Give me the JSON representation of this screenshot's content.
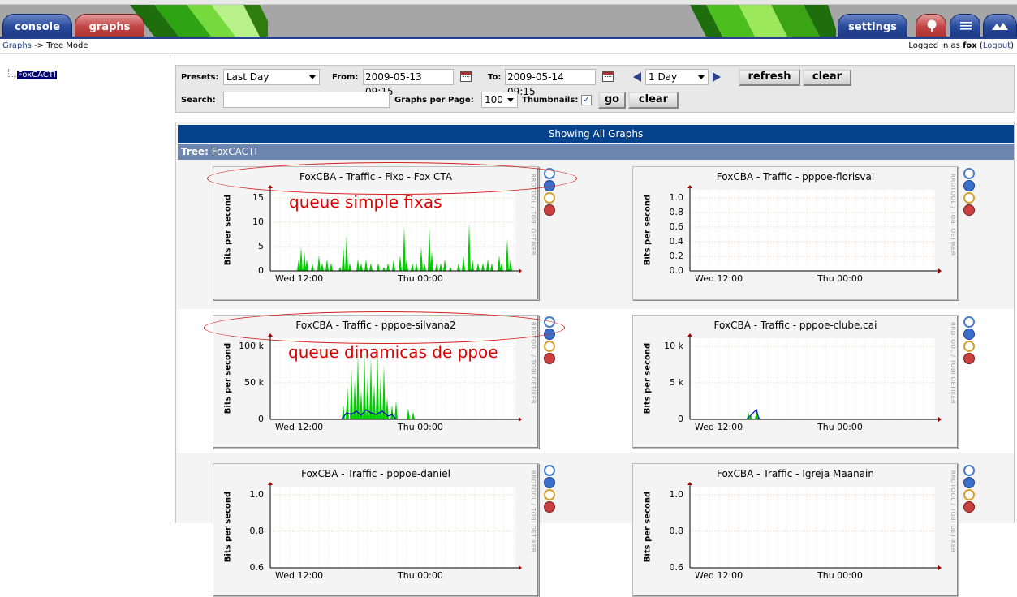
{
  "tabs": [
    {
      "label": "console"
    },
    {
      "label": "graphs"
    },
    {
      "label": "settings"
    }
  ],
  "breadcrumb": {
    "link": "Graphs",
    "separator": "->",
    "current": "Tree Mode"
  },
  "login": {
    "prefix": "Logged in as",
    "user": "fox",
    "logout": "Logout"
  },
  "tree": {
    "node": "FoxCACTI"
  },
  "filter": {
    "presets_label": "Presets:",
    "presets_value": "Last Day",
    "from_label": "From:",
    "from_value": "2009-05-13 09:15",
    "to_label": "To:",
    "to_value": "2009-05-14 09:15",
    "span_value": "1 Day",
    "refresh": "refresh",
    "clear": "clear",
    "search_label": "Search:",
    "search_value": "",
    "per_page_label": "Graphs per Page:",
    "per_page_value": "100",
    "thumbnails_label": "Thumbnails:",
    "thumbnails_checked": true,
    "go": "go",
    "clear2": "clear"
  },
  "section": {
    "showing": "Showing All Graphs",
    "tree_label": "Tree:",
    "tree_name": "FoxCACTI"
  },
  "graph_common": {
    "ylabel": "Bits per second",
    "side": "RRDTOOL / TOBI OETIKER",
    "x_ticks": [
      "Wed 12:00",
      "Thu 00:00"
    ]
  },
  "graphs": [
    {
      "title": "FoxCBA - Traffic - Fixo - Fox CTA",
      "y_ticks": [
        "15",
        "10",
        "5",
        "0"
      ],
      "y_max": 17
    },
    {
      "title": "FoxCBA - Traffic - pppoe-florisval",
      "y_ticks": [
        "1.0",
        "0.8",
        "0.6",
        "0.4",
        "0.2",
        "0.0"
      ],
      "y_max": 1.1
    },
    {
      "title": "FoxCBA - Traffic - pppoe-silvana2",
      "y_ticks": [
        "100 k",
        "50 k",
        "0"
      ],
      "y_max": 115
    },
    {
      "title": "FoxCBA - Traffic - pppoe-clube.cai",
      "y_ticks": [
        "10 k",
        "5 k",
        "0"
      ],
      "y_max": 15
    },
    {
      "title": "FoxCBA - Traffic - pppoe-daniel",
      "y_ticks": [
        "1.0",
        "0.8",
        "0.6"
      ],
      "y_max": 1.1
    },
    {
      "title": "FoxCBA - Traffic - Igreja Maanain",
      "y_ticks": [
        "1.0",
        "0.8",
        "0.6"
      ],
      "y_max": 1.1
    }
  ],
  "annotations": [
    "queue simple fixas",
    "queue dinamicas de ppoe"
  ],
  "colors": {
    "nav_blue": "#27418a",
    "header_blue": "#06418b",
    "tree_header": "#6c86b0",
    "traffic_in": "#00cc00",
    "traffic_out": "#0000ff",
    "annotation": "#e00000"
  }
}
